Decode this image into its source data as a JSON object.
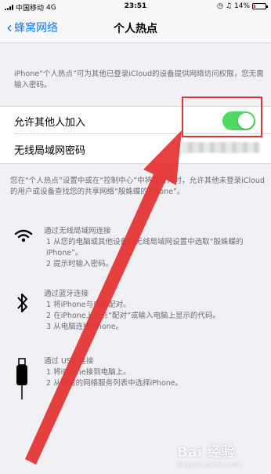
{
  "status": {
    "carrier": "中国移动",
    "network": "4G",
    "time": "23:51",
    "battery": "14%"
  },
  "nav": {
    "back": "蜂窝网络",
    "title": "个人热点"
  },
  "description_top": "iPhone“个人热点”可为其他已登录iCloud的设备提供网络访问权限，您无需输入密码。",
  "settings": {
    "allow_others": "允许其他人加入",
    "allow_others_on": true,
    "wifi_password_label": "无线局域网密码"
  },
  "description_mid": "您在“个人热点”设置中或在“控制中心”中将其打开时，允许其他未登录iCloud的用户或设备查找您的共享网络“殷姝蝶的iPhone”。",
  "sections": [
    {
      "icon": "wifi-icon",
      "title": "通过无线局域网连接",
      "steps": [
        "1 从您的电脑或其他设备的无线局域网设置中选取“殷姝蝶的 iPhone”。",
        "2 提示时输入密码。"
      ]
    },
    {
      "icon": "bluetooth-icon",
      "title": "通过蓝牙连接",
      "steps": [
        "1 将iPhone与电脑配对。",
        "2 在iPhone上轻点“配对”或输入电脑上显示的代码。",
        "3 从电脑连接iPhone。"
      ]
    },
    {
      "icon": "usb-cable-icon",
      "title": "通过 USB 连接",
      "steps": [
        "1 将iPhone接到电脑上。",
        "2 从设置的网络服务列表中选择iPhone。"
      ]
    }
  ],
  "watermark": {
    "text": "Bai 经验",
    "sub": "jingyan.baidu.com"
  },
  "colors": {
    "accent": "#0a7aff",
    "switch_on": "#4cd964",
    "annotation": "#e53030",
    "background": "#efeff4"
  }
}
